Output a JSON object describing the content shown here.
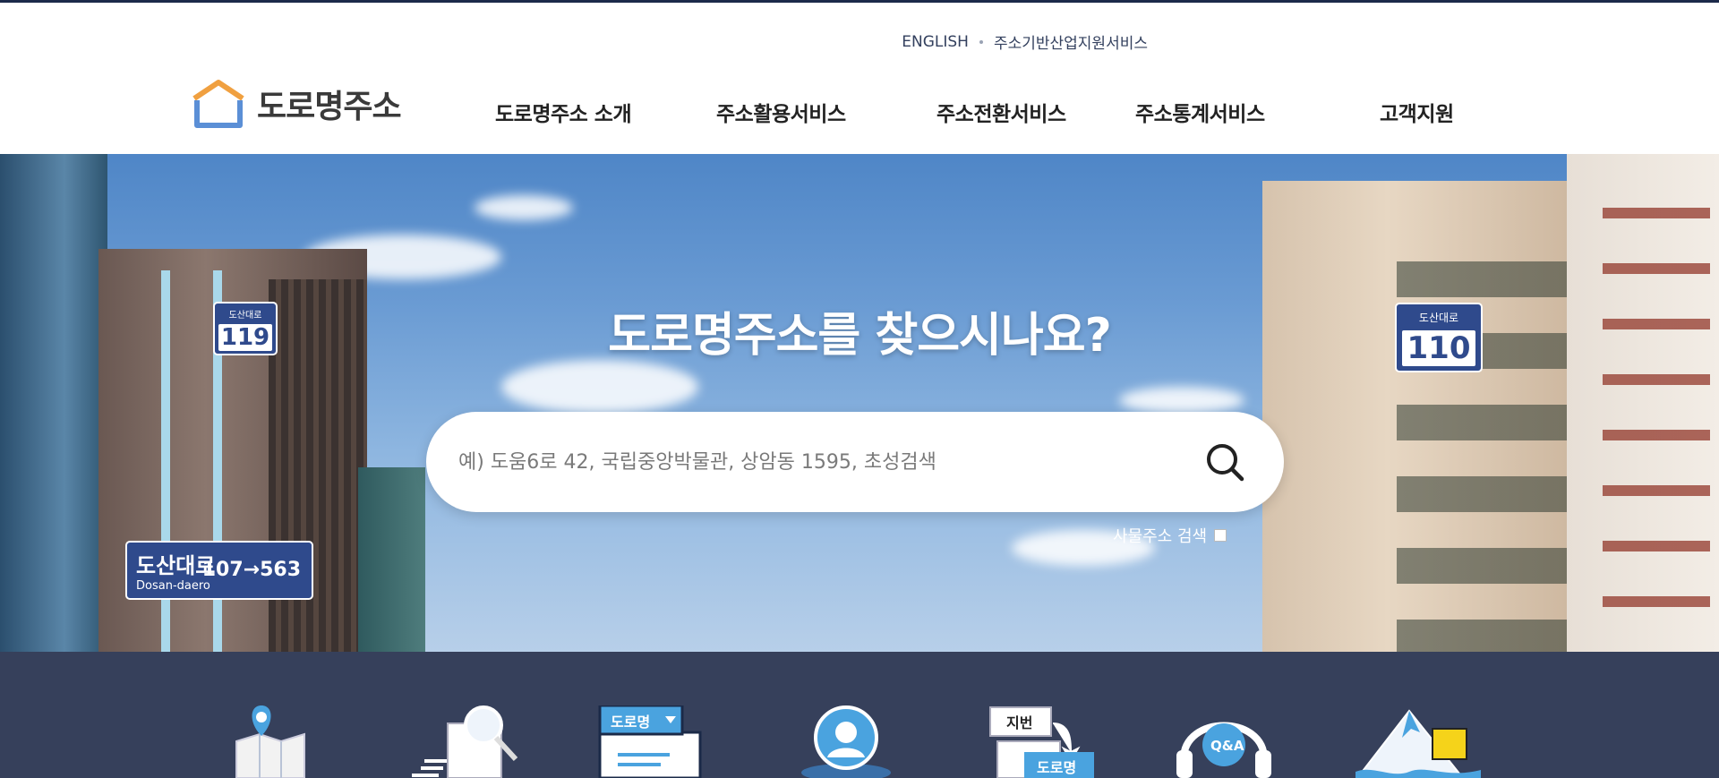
{
  "colors": {
    "brand_navy": "#2f4a8c",
    "quick_bar": "#303a56",
    "logo_orange": "#f0a040",
    "logo_blue": "#5b8fd6"
  },
  "utility": {
    "english": "ENGLISH",
    "industry_support": "주소기반산업지원서비스"
  },
  "logo": {
    "text": "도로명주소"
  },
  "gnb": [
    {
      "label": "도로명주소 소개"
    },
    {
      "label": "주소활용서비스"
    },
    {
      "label": "주소전환서비스"
    },
    {
      "label": "주소통계서비스"
    },
    {
      "label": "고객지원"
    }
  ],
  "hero": {
    "title": "도로명주소를 찾으시나요?",
    "search": {
      "placeholder": "예) 도움6로 42, 국립중앙박물관, 상암동 1595, 초성검색",
      "value": ""
    },
    "thing_search_label": "사물주소 검색",
    "signs": {
      "left_small": {
        "road": "도산대로",
        "num": "119"
      },
      "right_small": {
        "road": "도산대로",
        "num": "110"
      },
      "road_sign": {
        "road": "도산대로",
        "roman": "Dosan-daero",
        "range": "107→563"
      }
    }
  },
  "quick_icons": [
    {
      "icon": "map-pin-icon"
    },
    {
      "icon": "document-search-icon"
    },
    {
      "icon": "road-name-select-icon",
      "label": "도로명"
    },
    {
      "icon": "location-person-icon"
    },
    {
      "icon": "address-convert-icon",
      "label_top": "지번",
      "label_bottom": "도로명"
    },
    {
      "icon": "qna-headset-icon",
      "label": "Q&A"
    },
    {
      "icon": "mountain-sign-icon"
    }
  ]
}
